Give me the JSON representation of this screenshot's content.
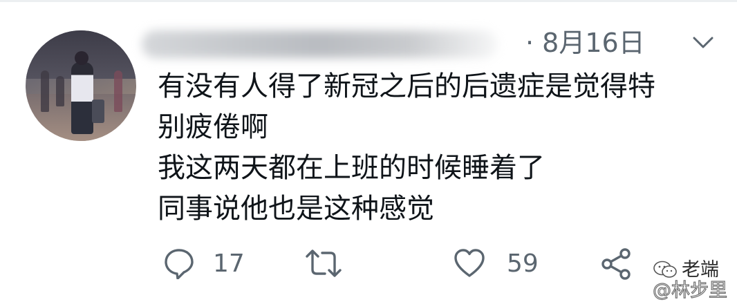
{
  "tweet": {
    "author_name": "",
    "date": "· 8月16日",
    "text_lines": [
      "有没有人得了新冠之后的后遗症是觉得特",
      "别疲倦啊",
      "我这两天都在上班的时候睡着了",
      "同事说他也是这种感觉"
    ]
  },
  "actions": {
    "reply_count": "17",
    "retweet_count": "",
    "like_count": "59"
  },
  "icons": {
    "more": "chevron-down-icon",
    "reply": "reply-bubble-icon",
    "retweet": "retweet-icon",
    "like": "heart-icon",
    "share": "share-icon",
    "watermark": "wechat-icon"
  },
  "watermark": {
    "line1": "老端",
    "line2": "@林步里"
  },
  "colors": {
    "text": "#0f1419",
    "muted": "#5b6670",
    "background": "#ffffff"
  }
}
